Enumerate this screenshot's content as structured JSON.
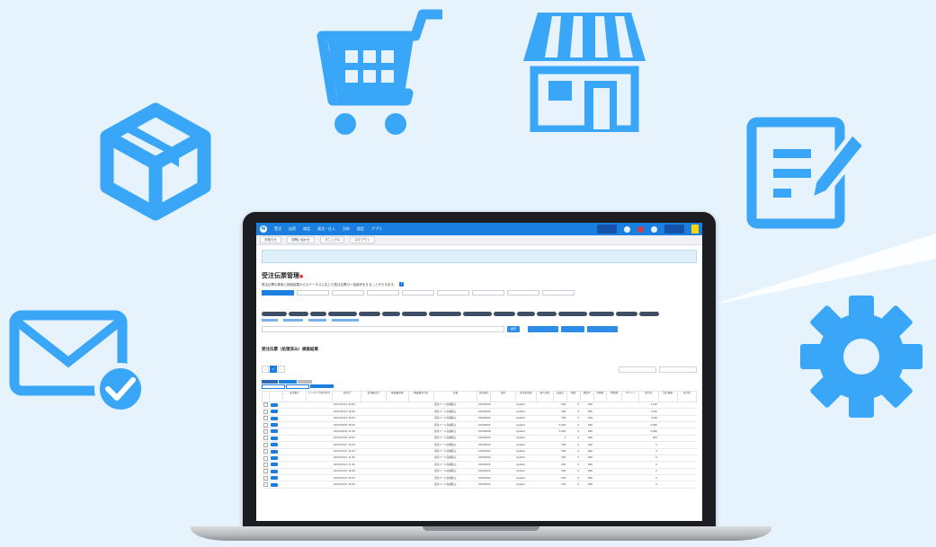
{
  "colors": {
    "background": "#e6f3fd",
    "icon_blue": "#3aa6f7",
    "app_header": "#1a7fe0"
  },
  "decorative_icons": [
    "package-box-icon",
    "shopping-cart-icon",
    "storefront-icon",
    "document-edit-icon",
    "email-check-icon",
    "gear-icon"
  ],
  "app": {
    "topnav": [
      "受注",
      "出荷",
      "商品",
      "発注・仕入",
      "分析",
      "設定",
      "アプリ"
    ],
    "subnav": [
      "お知らせ",
      "お問い合わせ",
      "マニュアル",
      "ログアウト"
    ],
    "page_title": "受注伝票管理",
    "page_title_mark": "●",
    "description": "受注伝票の検索と検索結果からステータスに応じた受注伝票の一括操作をすることができます。",
    "help_mark": "?",
    "search_button": "検索",
    "section_title": "受注伝票（処理済み）検索結果",
    "pager": [
      "‹",
      "1",
      "›"
    ],
    "table_headers": [
      "伝票番号",
      "ピッキング指示区分",
      "受注日",
      "出荷確定日",
      "納品書印刷",
      "納品書受付日",
      "店舗",
      "受注番号",
      "出荷",
      "受注担当者",
      "購入者名",
      "商品計",
      "税金",
      "発送代",
      "手数料",
      "他費用",
      "ポイント",
      "総合計",
      "合計差額",
      "送り先"
    ],
    "table_rows": [
      {
        "date": "2022/10/13 20:00",
        "shop": "受注メール自動取込",
        "order": "100000024",
        "user": "System",
        "sub": "500",
        "tax": "0",
        "ship": "660",
        "total": "1,160"
      },
      {
        "date": "2022/10/13 16:56",
        "shop": "受注メール自動取込",
        "order": "100000023",
        "user": "System",
        "sub": "500",
        "tax": "0",
        "ship": "660",
        "total": "1,160"
      },
      {
        "date": "2022/10/13 16:52",
        "shop": "受注メール自動取込",
        "order": "100000022",
        "user": "System",
        "sub": "500",
        "tax": "0",
        "ship": "660",
        "total": "1,160"
      },
      {
        "date": "2022/09/30 18:20",
        "shop": "受注メール自動取込",
        "order": "100000021",
        "user": "System",
        "sub": "5,000",
        "tax": "0",
        "ship": "660",
        "total": "5,660"
      },
      {
        "date": "2022/09/30 11:56",
        "shop": "受注メール自動取込",
        "order": "100000020",
        "user": "System",
        "sub": "5,000",
        "tax": "0",
        "ship": "660",
        "total": "5,660"
      },
      {
        "date": "2022/07/01 10:45",
        "shop": "受注メール自動取込",
        "order": "100000019",
        "user": "System",
        "sub": "1",
        "tax": "0",
        "ship": "660",
        "total": "661"
      },
      {
        "date": "2022/01/17 16:24",
        "shop": "受注メール自動取込",
        "order": "100000018",
        "user": "System",
        "sub": "500",
        "tax": "0",
        "ship": "660",
        "total": "0"
      },
      {
        "date": "2022/01/13 12:23",
        "shop": "受注メール自動取込",
        "order": "100000017",
        "user": "System",
        "sub": "500",
        "tax": "0",
        "ship": "660",
        "total": "0"
      },
      {
        "date": "2022/01/12 11:56",
        "shop": "受注メール自動取込",
        "order": "100000016",
        "user": "System",
        "sub": "500",
        "tax": "0",
        "ship": "660",
        "total": "0"
      },
      {
        "date": "2022/01/11 11:50",
        "shop": "受注メール自動取込",
        "order": "100000015",
        "user": "System",
        "sub": "500",
        "tax": "0",
        "ship": "660",
        "total": "0"
      },
      {
        "date": "2022/01/07 16:46",
        "shop": "受注メール自動取込",
        "order": "100000014",
        "user": "System",
        "sub": "500",
        "tax": "0",
        "ship": "660",
        "total": "0"
      },
      {
        "date": "2022/01/07 16:25",
        "shop": "受注メール自動取込",
        "order": "100000013",
        "user": "System",
        "sub": "500",
        "tax": "0",
        "ship": "660",
        "total": "0"
      },
      {
        "date": "2022/01/07 16:20",
        "shop": "受注メール自動取込",
        "order": "100000012",
        "user": "System",
        "sub": "500",
        "tax": "0",
        "ship": "660",
        "total": "0"
      }
    ]
  }
}
